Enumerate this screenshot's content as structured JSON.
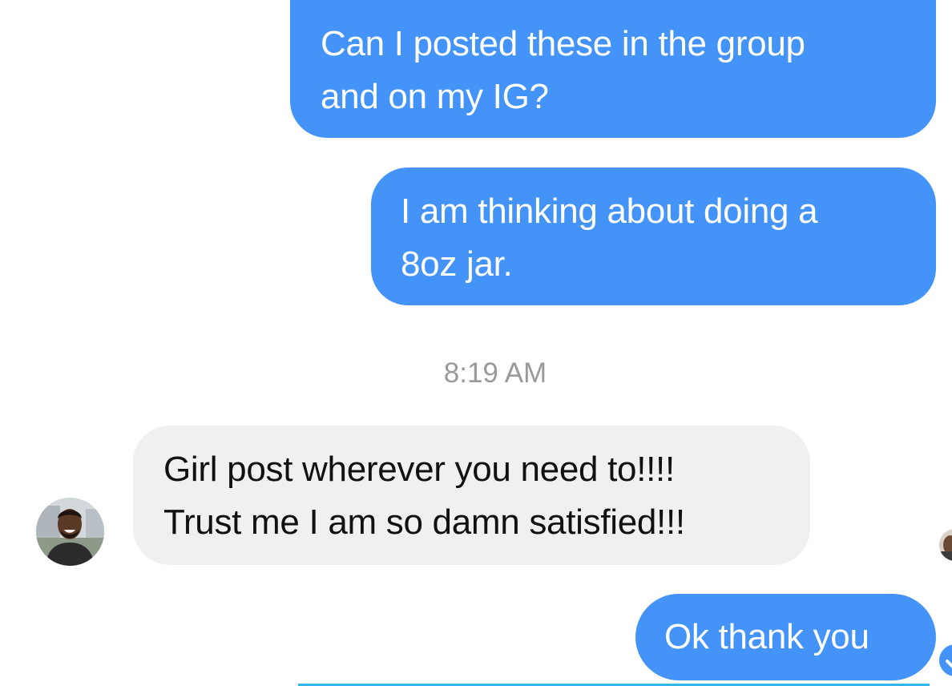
{
  "conversation": {
    "messages": [
      {
        "direction": "outgoing",
        "lines": [
          "Can I posted these in the group",
          "and on my IG?"
        ]
      },
      {
        "direction": "outgoing",
        "lines": [
          "I am thinking about doing a",
          "8oz jar."
        ]
      },
      {
        "direction": "incoming",
        "lines": [
          "Girl post wherever you need to!!!!",
          "Trust me I am so damn satisfied!!!"
        ]
      },
      {
        "direction": "outgoing",
        "lines": [
          "Ok thank you"
        ]
      }
    ],
    "timestamp": "8:19 AM"
  },
  "icons": {
    "contact_avatar": "contact-avatar",
    "seen_avatar": "seen-avatar",
    "delivered": "delivered-check-icon"
  },
  "colors": {
    "outgoing_bubble": "#4493f8",
    "incoming_bubble": "#f0f0f0",
    "timestamp_text": "#9a9a9a"
  }
}
